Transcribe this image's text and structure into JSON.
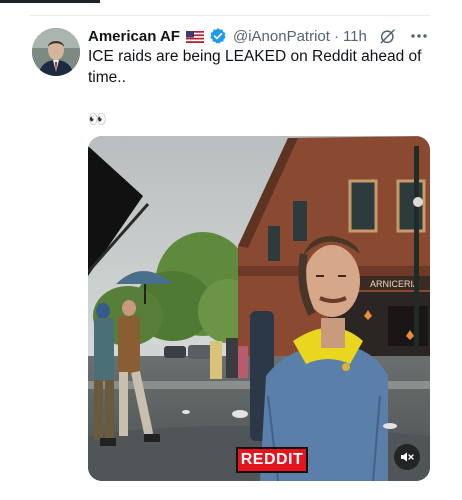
{
  "tweet": {
    "author": {
      "display_name": "American AF",
      "flag_icon": "us-flag-icon",
      "verified_icon": "verified-badge-icon",
      "handle": "@iAnonPatriot",
      "separator": "·",
      "time": "11h"
    },
    "actions": {
      "grok_icon": "grok-icon",
      "more_icon": "more-options-icon"
    },
    "text_lines": [
      "ICE raids are being LEAKED on Reddit ahead of",
      "time.."
    ],
    "emoji": "👀",
    "media": {
      "overlay_label": "REDDIT",
      "storefront_sign": "ARNICERIA",
      "mute_icon": "volume-muted-icon"
    }
  },
  "colors": {
    "text": "#0f1419",
    "secondary_text": "#536471",
    "verified_blue": "#1d9bf0",
    "reddit_red": "#e5141e"
  }
}
